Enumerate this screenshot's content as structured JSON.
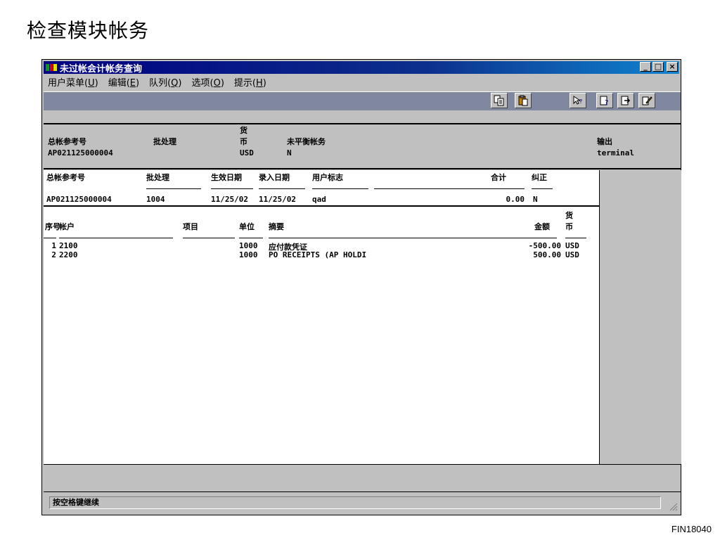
{
  "page": {
    "title": "检查模块帐务",
    "code": "FIN18040"
  },
  "window": {
    "title": "未过帐会计帐务查询",
    "controls": {
      "minimize": "_",
      "maximize": "□",
      "close": "×"
    }
  },
  "menu": [
    {
      "label": "用户菜单",
      "key": "U"
    },
    {
      "label": "编辑",
      "key": "E"
    },
    {
      "label": "队列",
      "key": "Q"
    },
    {
      "label": "选项",
      "key": "O"
    },
    {
      "label": "提示",
      "key": "H"
    }
  ],
  "header": {
    "ref_label": "总帐参考号",
    "ref_value": "AP021125000004",
    "batch_label": "批处理",
    "curr_label_1": "货",
    "curr_label_2": "币",
    "curr_value": "USD",
    "unbal_label": "未平衡帐务",
    "unbal_value": "N",
    "output_label": "输出",
    "output_value": "terminal"
  },
  "entry": {
    "labels": {
      "ref": "总帐参考号",
      "batch": "批处理",
      "eff_date": "生效日期",
      "entry_date": "录入日期",
      "user": "用户标志",
      "total": "合计",
      "correct": "纠正"
    },
    "values": {
      "ref": "AP021125000004",
      "batch": "1004",
      "eff_date": "11/25/02",
      "entry_date": "11/25/02",
      "user": "qad",
      "total": "0.00",
      "correct": "N"
    }
  },
  "lines": {
    "headers": {
      "seq": "序号",
      "account": "帐户",
      "project": "项目",
      "unit": "单位",
      "desc": "摘要",
      "amount": "金额",
      "curr_1": "货",
      "curr_2": "币"
    },
    "rows": [
      {
        "seq": "1",
        "account": "2100",
        "unit": "1000",
        "desc": "应付款凭证",
        "amount": "-500.00",
        "curr": "USD"
      },
      {
        "seq": "2",
        "account": "2200",
        "unit": "1000",
        "desc": "PO RECEIPTS (AP HOLDI",
        "amount": "500.00",
        "curr": "USD"
      }
    ]
  },
  "status": {
    "text": "按空格键继续"
  }
}
